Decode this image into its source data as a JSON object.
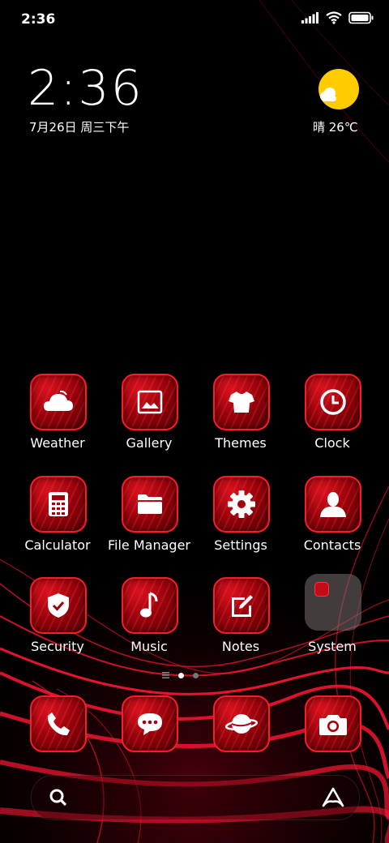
{
  "status_bar": {
    "time": "2:36",
    "icons": [
      "signal-icon",
      "wifi-icon",
      "battery-icon"
    ]
  },
  "clock_widget": {
    "time": "2:36",
    "date": "7月26日 周三下午"
  },
  "weather_widget": {
    "condition_icon": "sun-cloud-icon",
    "text": "晴 26℃",
    "sun_color": "#FFCC00"
  },
  "apps": [
    {
      "label": "Weather",
      "icon": "cloud-icon"
    },
    {
      "label": "Gallery",
      "icon": "image-icon"
    },
    {
      "label": "Themes",
      "icon": "tshirt-icon"
    },
    {
      "label": "Clock",
      "icon": "clock-icon"
    },
    {
      "label": "Calculator",
      "icon": "calculator-icon"
    },
    {
      "label": "File Manager",
      "icon": "folder-icon"
    },
    {
      "label": "Settings",
      "icon": "gear-icon"
    },
    {
      "label": "Contacts",
      "icon": "person-icon"
    },
    {
      "label": "Security",
      "icon": "shield-check-icon"
    },
    {
      "label": "Music",
      "icon": "music-note-icon"
    },
    {
      "label": "Notes",
      "icon": "note-edit-icon"
    },
    {
      "label": "System",
      "icon": "folder-group-icon"
    }
  ],
  "page_indicator": {
    "pages": 2,
    "current": 1
  },
  "dock": [
    {
      "icon": "phone-icon"
    },
    {
      "icon": "chat-bubble-icon"
    },
    {
      "icon": "planet-icon"
    },
    {
      "icon": "camera-icon"
    }
  ],
  "search_bar": {
    "left_icon": "search-icon",
    "right_icon": "assistant-icon"
  },
  "theme": {
    "accent": "#E0101E",
    "border": "#FF1A28",
    "wallpaper": "#000000"
  }
}
